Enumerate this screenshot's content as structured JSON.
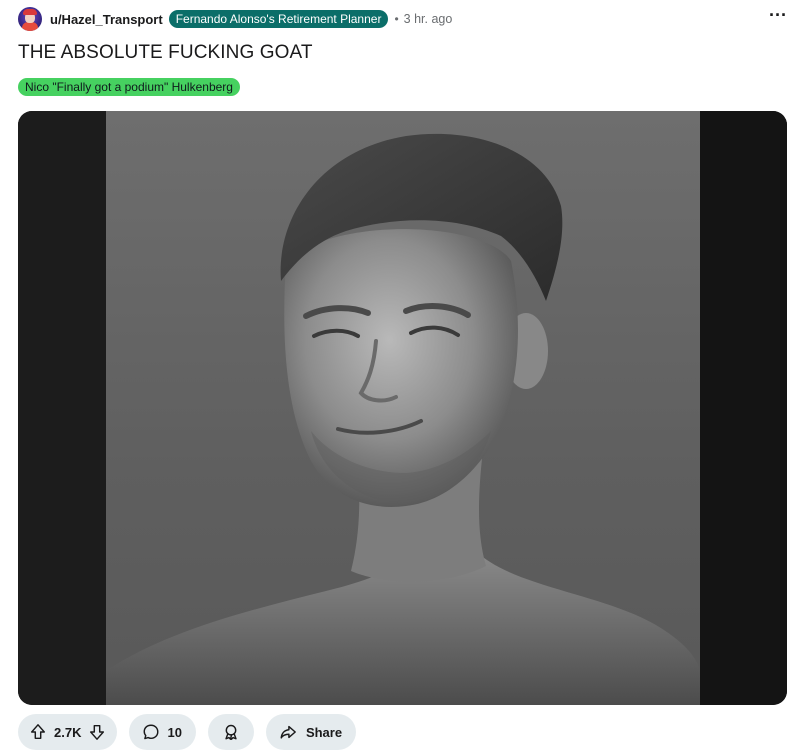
{
  "post": {
    "username": "u/Hazel_Transport",
    "user_flair": "Fernando Alonso's Retirement Planner",
    "separator": "•",
    "time_ago": "3 hr. ago",
    "more_label": "···",
    "title": "THE ABSOLUTE FUCKING GOAT",
    "post_flair": "Nico \"Finally got a podium\" Hulkenberg",
    "colors": {
      "user_flair_bg": "#0b6e69",
      "post_flair_bg": "#46d160",
      "action_pill_bg": "#e5ebee"
    }
  },
  "media": {
    "description_icon": "portrait-photo"
  },
  "actions": {
    "upvote_icon": "arrow-up-icon",
    "vote_count": "2.7K",
    "downvote_icon": "arrow-down-icon",
    "comment_icon": "comment-bubble-icon",
    "comment_count": "10",
    "award_icon": "award-ribbon-icon",
    "share_icon": "share-arrow-icon",
    "share_label": "Share"
  }
}
